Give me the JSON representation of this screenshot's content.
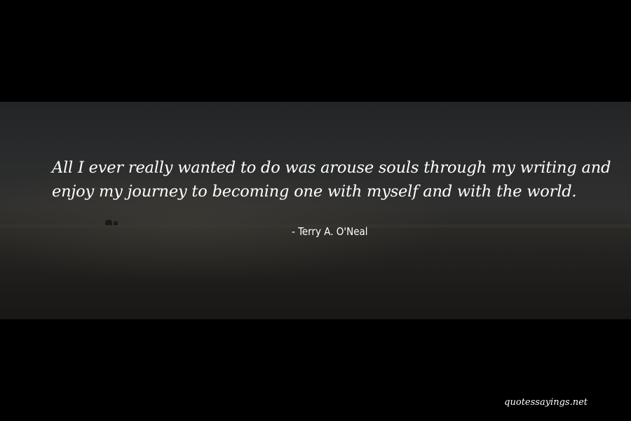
{
  "quote": {
    "line1": "All I ever really wanted to do was arouse souls through my writing and",
    "line2": "enjoy my journey to becoming one with myself and with the world."
  },
  "author": "- Terry A. O'Neal",
  "watermark": "quotessayings.net"
}
